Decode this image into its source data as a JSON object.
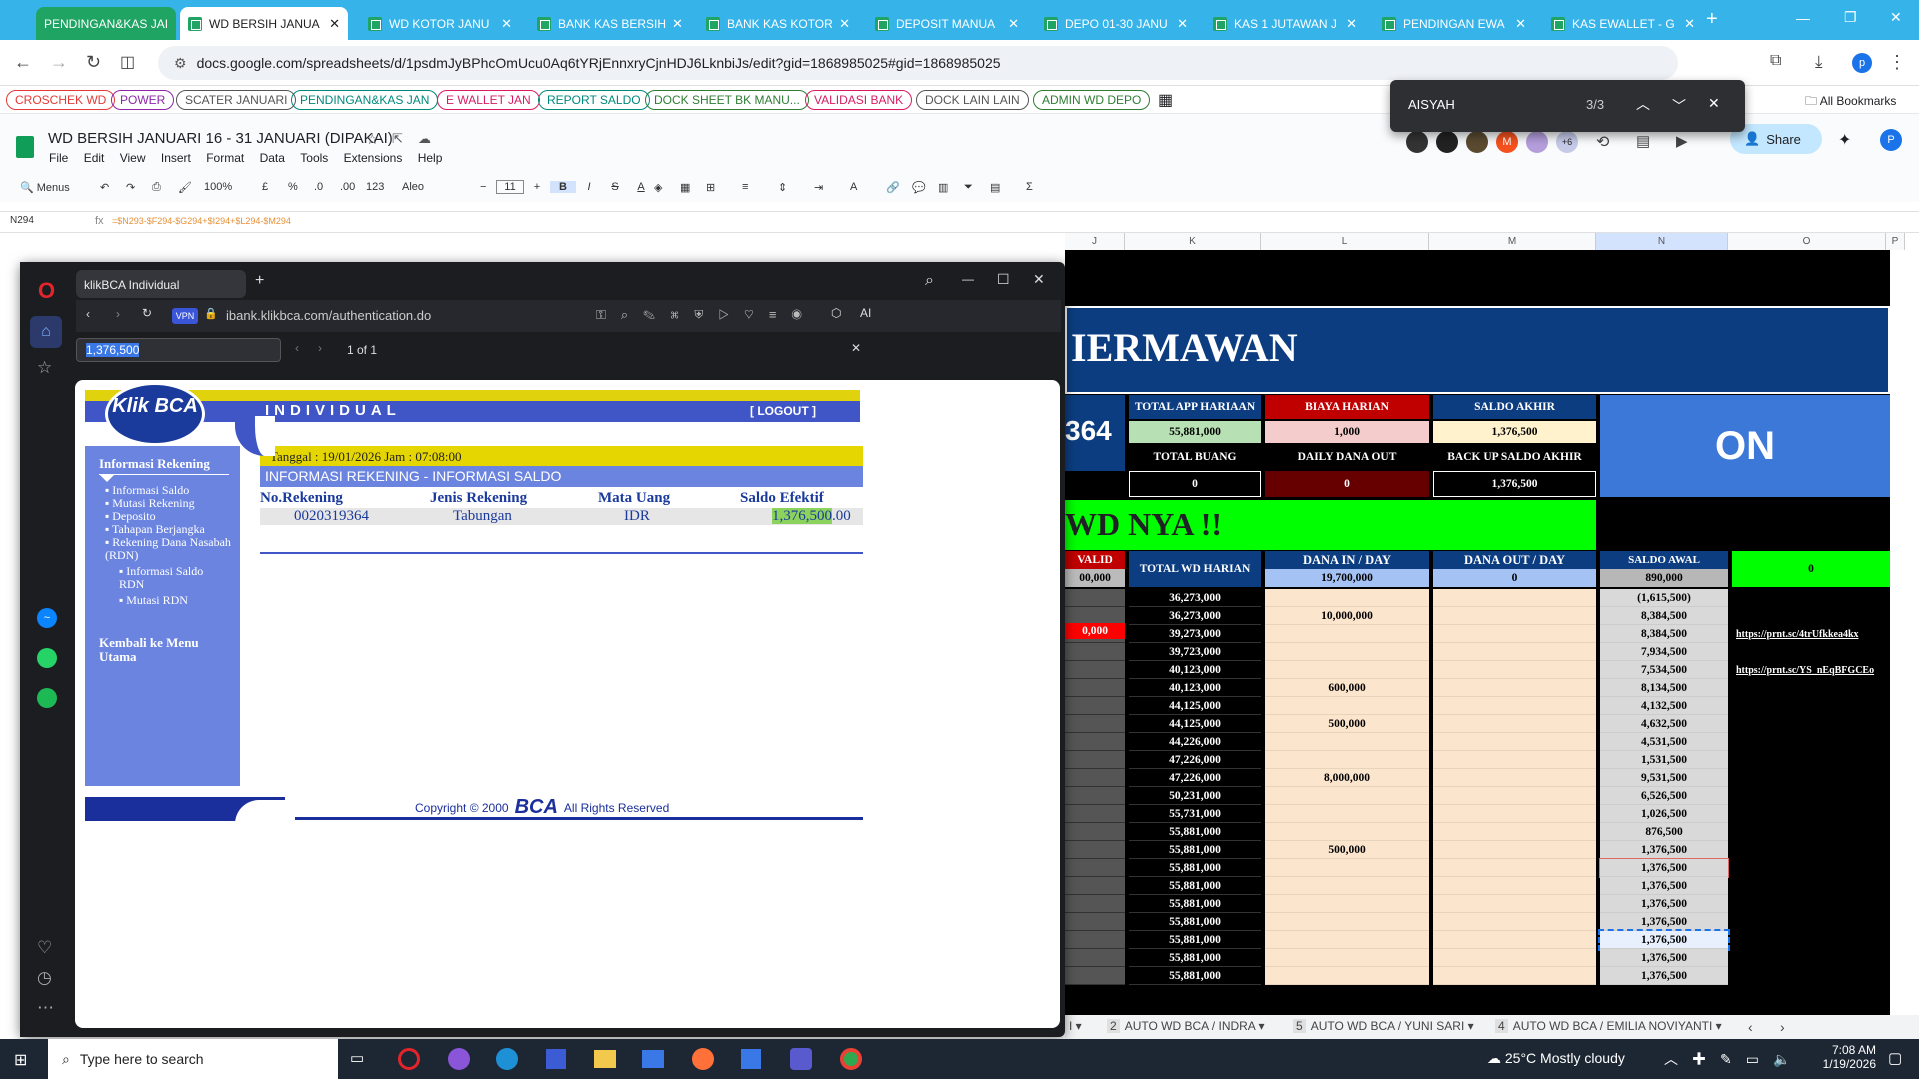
{
  "browser": {
    "tabs": [
      {
        "label": "PENDINGAN&KAS JAI",
        "active": false
      },
      {
        "label": "WD BERSIH JANUA",
        "active": true
      },
      {
        "label": "WD KOTOR JANU",
        "active": false
      },
      {
        "label": "BANK KAS BERSIH",
        "active": false
      },
      {
        "label": "BANK KAS KOTOR",
        "active": false
      },
      {
        "label": "DEPOSIT MANUA",
        "active": false
      },
      {
        "label": "DEPO 01-30 JANU",
        "active": false
      },
      {
        "label": "KAS 1 JUTAWAN J",
        "active": false
      },
      {
        "label": "PENDINGAN EWA",
        "active": false
      },
      {
        "label": "KAS EWALLET - G",
        "active": false
      }
    ],
    "url": "docs.google.com/spreadsheets/d/1psdmJyBPhcOmUcu0Aq6tYRjEnnxryCjnHDJ6LknbiJs/edit?gid=1868985025#gid=1868985025",
    "bookmarks": [
      {
        "label": "CROSCHEK WD",
        "color": "#e53935"
      },
      {
        "label": "POWER",
        "color": "#8e24aa"
      },
      {
        "label": "SCATER JANUARI",
        "color": "#555555"
      },
      {
        "label": "PENDINGAN&KAS JAN",
        "color": "#00897b"
      },
      {
        "label": "E WALLET JAN",
        "color": "#d81b60"
      },
      {
        "label": "REPORT SALDO",
        "color": "#00897b"
      },
      {
        "label": "DOCK SHEET BK MANU...",
        "color": "#2e7d32"
      },
      {
        "label": "VALIDASI BANK",
        "color": "#d81b60"
      },
      {
        "label": "DOCK LAIN LAIN",
        "color": "#555555"
      },
      {
        "label": "ADMIN WD DEPO",
        "color": "#2e7d32"
      }
    ],
    "all_bookmarks": "All Bookmarks",
    "find": {
      "query": "AISYAH",
      "count": "3/3"
    }
  },
  "sheets": {
    "title": "WD BERSIH JANUARI 16 - 31 JANUARI (DIPAKAI)",
    "menu": [
      "File",
      "Edit",
      "View",
      "Insert",
      "Format",
      "Data",
      "Tools",
      "Extensions",
      "Help"
    ],
    "toolbar": {
      "menus": "Menus",
      "zoom": "100%",
      "currency": "£",
      "percent": "%",
      "dec_dec": ".0",
      "dec_inc": ".00",
      "num": "123",
      "font": "Aleo",
      "size": "11",
      "bold": "B",
      "italic": "I",
      "strike": "S",
      "underline": "A"
    },
    "share": "Share",
    "avatar_more": "+6",
    "cell_ref": "N294",
    "formula": "=$N293-$F294-$G294+$I294+$L294-$M294",
    "col_letters": [
      "J",
      "K",
      "L",
      "M",
      "N",
      "O",
      "P"
    ],
    "banner": "IERMAWAN",
    "top_value": "364",
    "headers": {
      "total_app": "TOTAL APP HARIAAN",
      "biaya": "BIAYA HARIAN",
      "saldo_akhir": "SALDO AKHIR",
      "total_buang": "TOTAL BUANG",
      "daily_out": "DAILY DANA OUT",
      "backup": "BACK UP SALDO AKHIR",
      "total_wd": "TOTAL WD HARIAN",
      "dana_in": "DANA IN / DAY",
      "dana_out": "DANA OUT / DAY",
      "saldo_awal": "SALDO AWAL",
      "invalid": "VALID"
    },
    "values": {
      "total_app": "55,881,000",
      "biaya": "1,000",
      "saldo_akhir": "1,376,500",
      "total_buang": "0",
      "daily_out": "0",
      "backup": "1,376,500",
      "on": "ON",
      "wd_nya": "WD NYA !!",
      "dana_in": "19,700,000",
      "dana_out": "0",
      "saldo_awal": "890,000",
      "green_zero": "0",
      "left_000": "00,000",
      "red_000": "0,000"
    },
    "rows": [
      {
        "k": "36,273,000",
        "l": "",
        "n": "(1,615,500)",
        "o": ""
      },
      {
        "k": "36,273,000",
        "l": "10,000,000",
        "n": "8,384,500",
        "o": ""
      },
      {
        "k": "39,273,000",
        "l": "",
        "n": "8,384,500",
        "o": "https://prnt.sc/4trUfkkea4kx"
      },
      {
        "k": "39,723,000",
        "l": "",
        "n": "7,934,500",
        "o": ""
      },
      {
        "k": "40,123,000",
        "l": "",
        "n": "7,534,500",
        "o": "https://prnt.sc/YS_nEqBFGCEo"
      },
      {
        "k": "40,123,000",
        "l": "600,000",
        "n": "8,134,500",
        "o": ""
      },
      {
        "k": "44,125,000",
        "l": "",
        "n": "4,132,500",
        "o": ""
      },
      {
        "k": "44,125,000",
        "l": "500,000",
        "n": "4,632,500",
        "o": ""
      },
      {
        "k": "44,226,000",
        "l": "",
        "n": "4,531,500",
        "o": ""
      },
      {
        "k": "47,226,000",
        "l": "",
        "n": "1,531,500",
        "o": ""
      },
      {
        "k": "47,226,000",
        "l": "8,000,000",
        "n": "9,531,500",
        "o": ""
      },
      {
        "k": "50,231,000",
        "l": "",
        "n": "6,526,500",
        "o": ""
      },
      {
        "k": "55,731,000",
        "l": "",
        "n": "1,026,500",
        "o": ""
      },
      {
        "k": "55,881,000",
        "l": "",
        "n": "876,500",
        "o": ""
      },
      {
        "k": "55,881,000",
        "l": "500,000",
        "n": "1,376,500",
        "o": ""
      },
      {
        "k": "55,881,000",
        "l": "",
        "n": "1,376,500",
        "o": ""
      },
      {
        "k": "55,881,000",
        "l": "",
        "n": "1,376,500",
        "o": ""
      },
      {
        "k": "55,881,000",
        "l": "",
        "n": "1,376,500",
        "o": ""
      },
      {
        "k": "55,881,000",
        "l": "",
        "n": "1,376,500",
        "o": ""
      },
      {
        "k": "55,881,000",
        "l": "",
        "n": "1,376,500",
        "o": ""
      },
      {
        "k": "55,881,000",
        "l": "",
        "n": "1,376,500",
        "o": ""
      },
      {
        "k": "55,881,000",
        "l": "",
        "n": "1,376,500",
        "o": ""
      }
    ],
    "sheet_tabs": [
      {
        "num": "2",
        "label": "AUTO WD BCA / INDRA"
      },
      {
        "num": "5",
        "label": "AUTO WD BCA / YUNI SARI"
      },
      {
        "num": "4",
        "label": "AUTO WD BCA / EMILIA NOVIYANTI"
      }
    ]
  },
  "bca": {
    "tab_title": "klikBCA Individual",
    "url": "ibank.klikbca.com/authentication.do",
    "find_query": "1,376,500",
    "find_count": "1 of 1",
    "logo": "Klik BCA",
    "individual": "INDIVIDUAL",
    "logout": "[ LOGOUT ]",
    "menu_title": "Informasi Rekening",
    "menu_items": [
      "Informasi Saldo",
      "Mutasi Rekening",
      "Deposito",
      "Tahapan Berjangka",
      "Rekening Dana Nasabah (RDN)"
    ],
    "sub_items": [
      "Informasi Saldo RDN",
      "Mutasi RDN"
    ],
    "back": "Kembali ke Menu Utama",
    "date": "Tanggal : 19/01/2026 Jam : 07:08:00",
    "section": "INFORMASI REKENING - INFORMASI SALDO",
    "cols": [
      "No.Rekening",
      "Jenis Rekening",
      "Mata Uang",
      "Saldo Efektif"
    ],
    "row": {
      "account": "0020319364",
      "type": "Tabungan",
      "currency": "IDR",
      "balance_hl": "1,376,500",
      "balance_dec": ".00"
    },
    "copyright": "Copyright © 2000",
    "bca_word": "BCA",
    "rights": "All Rights Reserved"
  },
  "taskbar": {
    "search": "Type here to search",
    "weather": "25°C  Mostly cloudy",
    "time": "7:08 AM",
    "date": "1/19/2026"
  }
}
